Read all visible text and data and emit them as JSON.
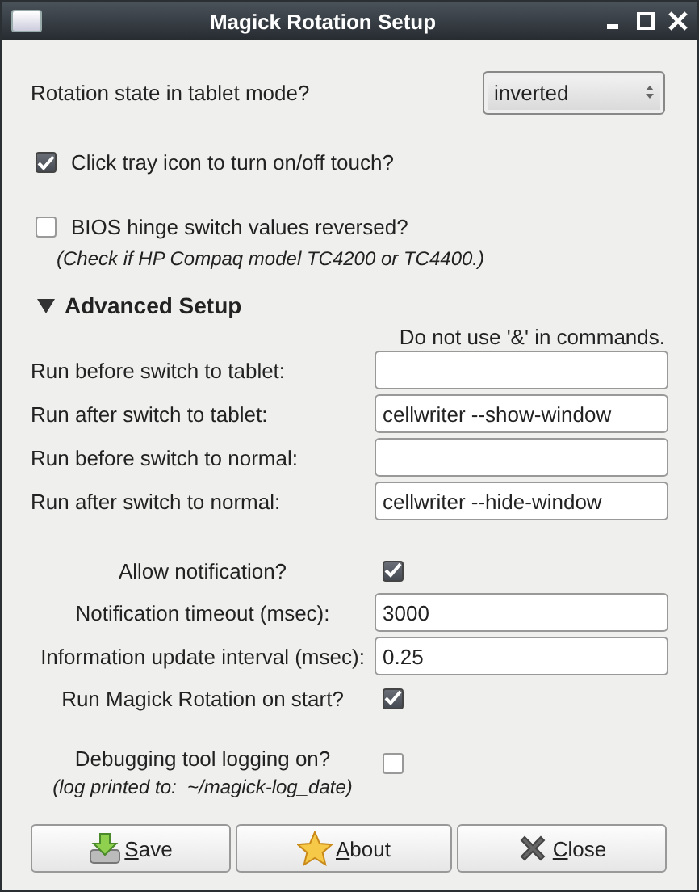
{
  "window": {
    "title": "Magick Rotation Setup"
  },
  "rotation": {
    "label": "Rotation state in tablet mode?",
    "value": "inverted"
  },
  "options": [
    {
      "label": "Click tray icon to turn on/off touch?",
      "checked": true
    },
    {
      "label": "BIOS hinge switch values reversed?",
      "checked": false,
      "note": "(Check if HP Compaq model TC4200 or TC4400.)"
    }
  ],
  "advanced": {
    "label": "Advanced Setup",
    "expanded": true,
    "hint": "Do not use '&' in commands.",
    "commands": [
      {
        "label": "Run before switch to tablet:"
      },
      {
        "label": "Run after switch to tablet:",
        "value": "cellwriter --show-window"
      },
      {
        "label": "Run before switch to normal:"
      },
      {
        "label": "Run after switch to normal:",
        "value": "cellwriter --hide-window"
      }
    ],
    "settings": [
      {
        "kind": "checkbox",
        "label": "Allow notification?",
        "checked": true
      },
      {
        "kind": "field",
        "label": "Notification timeout (msec):",
        "value": "3000"
      },
      {
        "kind": "field",
        "label": "Information update interval (msec):",
        "value": "0.25"
      },
      {
        "kind": "checkbox",
        "label": "Run Magick Rotation on start?",
        "checked": true
      },
      {
        "kind": "checkbox",
        "label": "Debugging tool logging on?",
        "checked": false,
        "note": "(log printed to:  ~/magick-log_date)"
      }
    ]
  },
  "buttons": [
    {
      "kind": "save",
      "label": "Save"
    },
    {
      "kind": "about",
      "label": "About"
    },
    {
      "kind": "close",
      "label": "Close"
    }
  ]
}
